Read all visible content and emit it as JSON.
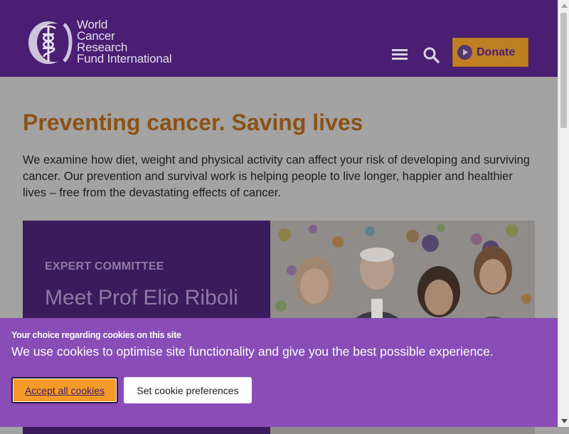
{
  "header": {
    "logo": {
      "lines": [
        "World",
        "Cancer",
        "Research",
        "Fund International"
      ]
    },
    "menu_icon": "hamburger-menu-icon",
    "search_icon": "search-icon",
    "donate": {
      "label": "Donate",
      "icon": "play-circle-icon"
    }
  },
  "main": {
    "headline": "Preventing cancer. Saving lives",
    "intro": "We examine how diet, weight and physical activity can affect your risk of developing and surviving cancer. Our prevention and survival work is helping people to live longer, happier and healthier lives – free from the devastating effects of cancer.",
    "feature": {
      "kicker": "EXPERT COMMITTEE",
      "title": "Meet Prof Elio Riboli"
    }
  },
  "cookie_banner": {
    "heading": "Your choice regarding cookies on this site",
    "text": "We use cookies to optimise site functionality and give you the best possible experience.",
    "accept_label": "Accept all cookies",
    "preferences_label": "Set cookie preferences"
  },
  "colors": {
    "header_bg": "#4a1f73",
    "headline": "#8c5215",
    "donate_bg": "#c17f24",
    "cookie_bg": "#8a4cb6",
    "accept_bg": "#f39a27"
  }
}
